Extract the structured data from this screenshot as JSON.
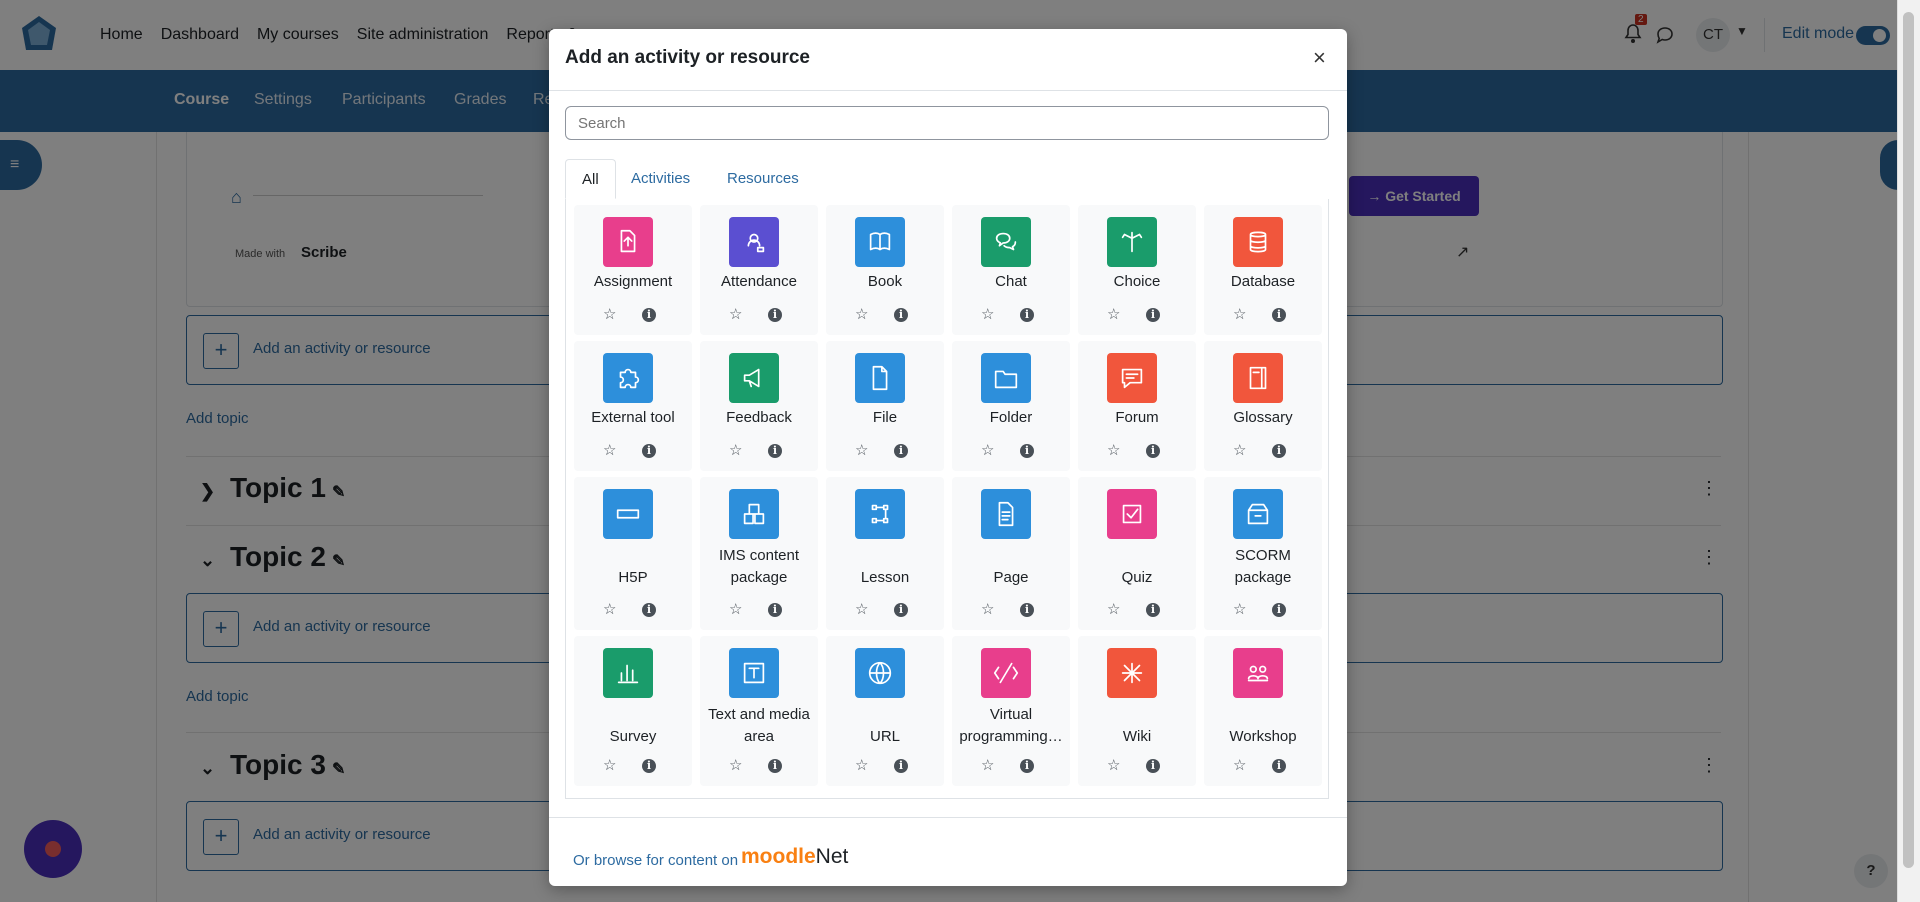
{
  "topnav": {
    "links": [
      "Home",
      "Dashboard",
      "My courses",
      "Site administration",
      "Reports &"
    ],
    "notification_count": "2",
    "user_initials": "CT",
    "edit_mode_label": "Edit mode"
  },
  "secnav": {
    "tabs": [
      "Course",
      "Settings",
      "Participants",
      "Grades",
      "Re"
    ]
  },
  "background": {
    "scribe_made_with": "Made with",
    "scribe_brand": "Scribe",
    "get_started": "Get Started",
    "add_activity": "Add an activity or resource",
    "add_topic": "Add topic",
    "topics": [
      "Topic 1",
      "Topic 2",
      "Topic 3"
    ]
  },
  "modal": {
    "title": "Add an activity or resource",
    "close_symbol": "×",
    "search_placeholder": "Search",
    "tabs": [
      "All",
      "Activities",
      "Resources"
    ],
    "items": [
      {
        "name": "Assignment",
        "color": "#e83e8c",
        "icon": "assignment-icon"
      },
      {
        "name": "Attendance",
        "color": "#5b4fd1",
        "icon": "attendance-icon"
      },
      {
        "name": "Book",
        "color": "#2d8fdb",
        "icon": "book-icon"
      },
      {
        "name": "Chat",
        "color": "#1a9c6b",
        "icon": "chat-icon"
      },
      {
        "name": "Choice",
        "color": "#1a9c6b",
        "icon": "choice-icon"
      },
      {
        "name": "Database",
        "color": "#f1563c",
        "icon": "database-icon"
      },
      {
        "name": "External tool",
        "color": "#2d8fdb",
        "icon": "external-tool-icon"
      },
      {
        "name": "Feedback",
        "color": "#1a9c6b",
        "icon": "feedback-icon"
      },
      {
        "name": "File",
        "color": "#2d8fdb",
        "icon": "file-icon"
      },
      {
        "name": "Folder",
        "color": "#2d8fdb",
        "icon": "folder-icon"
      },
      {
        "name": "Forum",
        "color": "#f1563c",
        "icon": "forum-icon"
      },
      {
        "name": "Glossary",
        "color": "#f1563c",
        "icon": "glossary-icon"
      },
      {
        "name": "H5P",
        "color": "#2d8fdb",
        "icon": "h5p-icon"
      },
      {
        "name": "IMS content package",
        "color": "#2d8fdb",
        "icon": "ims-package-icon"
      },
      {
        "name": "Lesson",
        "color": "#2d8fdb",
        "icon": "lesson-icon"
      },
      {
        "name": "Page",
        "color": "#2d8fdb",
        "icon": "page-icon"
      },
      {
        "name": "Quiz",
        "color": "#e83e8c",
        "icon": "quiz-icon"
      },
      {
        "name": "SCORM package",
        "color": "#2d8fdb",
        "icon": "scorm-icon"
      },
      {
        "name": "Survey",
        "color": "#1a9c6b",
        "icon": "survey-icon"
      },
      {
        "name": "Text and media area",
        "color": "#2d8fdb",
        "icon": "text-media-icon"
      },
      {
        "name": "URL",
        "color": "#2d8fdb",
        "icon": "url-icon"
      },
      {
        "name": "Virtual programming…",
        "color": "#e83e8c",
        "icon": "vpl-icon"
      },
      {
        "name": "Wiki",
        "color": "#f1563c",
        "icon": "wiki-icon"
      },
      {
        "name": "Workshop",
        "color": "#e83e8c",
        "icon": "workshop-icon"
      }
    ],
    "footer_text": "Or browse for content on",
    "moodlenet_m": "moodle",
    "moodlenet_net": "Net"
  }
}
